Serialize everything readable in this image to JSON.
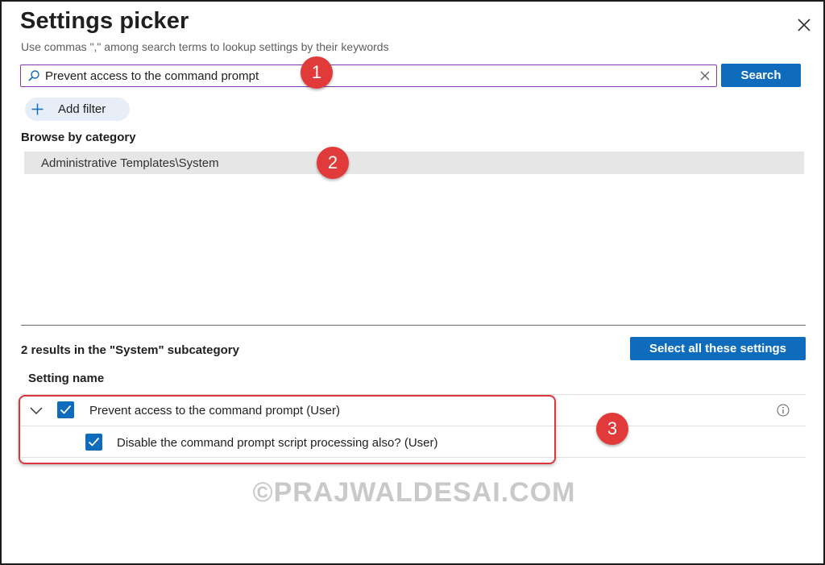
{
  "dialog": {
    "title": "Settings picker",
    "subtitle": "Use commas \",\" among search terms to lookup settings by their keywords",
    "close_icon": "close-icon"
  },
  "search": {
    "value": "Prevent access to the command prompt",
    "placeholder": "",
    "button_label": "Search",
    "icon": "search-icon",
    "clear_icon": "clear-icon"
  },
  "filter": {
    "add_filter_label": "Add filter",
    "icon": "plus-icon"
  },
  "browse": {
    "heading": "Browse by category",
    "categories": [
      "Administrative Templates\\System"
    ]
  },
  "results": {
    "heading": "2 results in the \"System\" subcategory",
    "select_all_label": "Select all these settings",
    "column_header": "Setting name",
    "settings": [
      {
        "label": "Prevent access to the command prompt (User)",
        "checked": true,
        "expandable": true
      },
      {
        "label": "Disable the command prompt script processing also? (User)",
        "checked": true,
        "expandable": false
      }
    ]
  },
  "annotations": {
    "markers": [
      "1",
      "2",
      "3"
    ],
    "color": "#e03a3a"
  },
  "watermark": "©PRAJWALDESAI.COM",
  "colors": {
    "accent": "#0f6cbd",
    "search_border": "#8a3ab9",
    "category_bg": "#e6e6e6",
    "filter_bg": "#e8eef8"
  }
}
